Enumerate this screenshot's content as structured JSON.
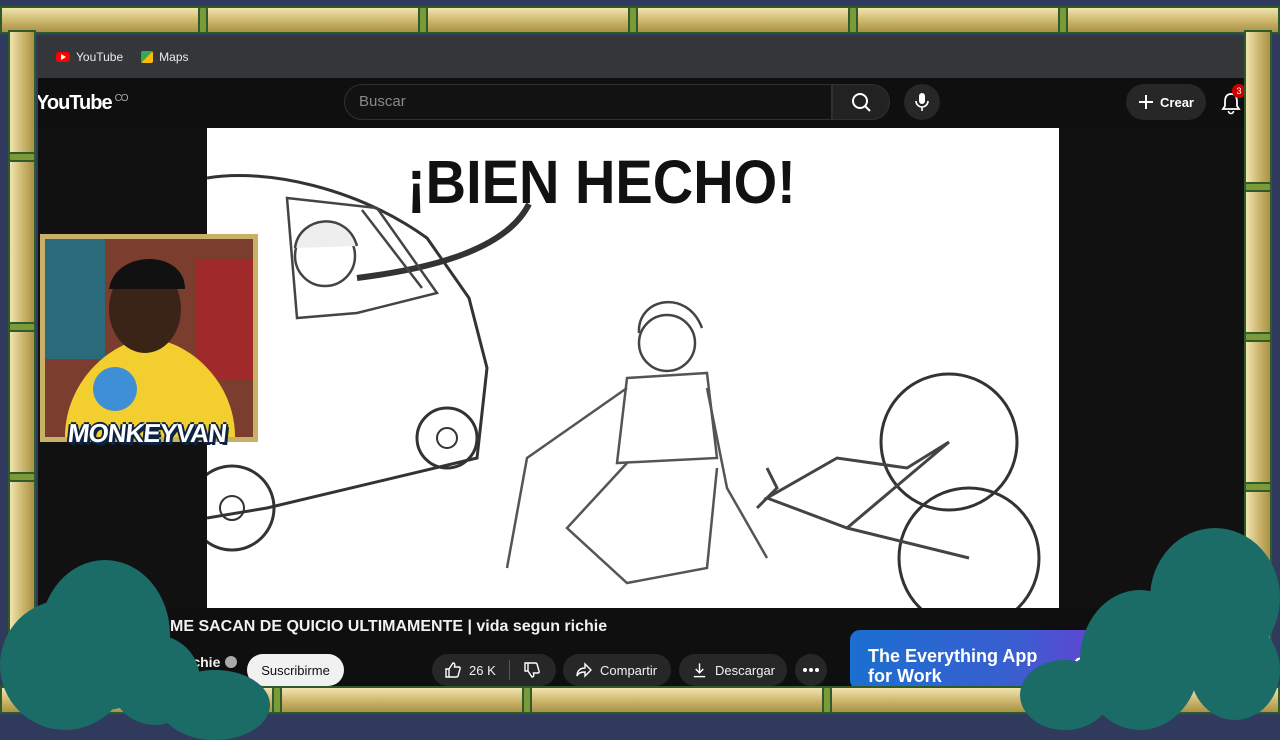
{
  "bookmarks": [
    {
      "label": "YouTube",
      "icon": "youtube-icon"
    },
    {
      "label": "Maps",
      "icon": "maps-icon"
    }
  ],
  "header": {
    "logo_text": "YouTube",
    "logo_country": "CO",
    "search_placeholder": "Buscar",
    "create_label": "Crear",
    "notification_count": "3"
  },
  "video": {
    "speech_bubble": "¡BIEN HECHO!",
    "title": "ME SACAN DE QUICIO ULTIMAMENTE | vida segun richie",
    "channel_name": "richie",
    "subscribe_label": "Suscribirme",
    "like_count": "26 K",
    "share_label": "Compartir",
    "download_label": "Descargar"
  },
  "ad": {
    "headline": "The Everything App for Work",
    "cta": "Get"
  },
  "overlay": {
    "streamer_logo": "MONKEYVAN"
  },
  "colors": {
    "bamboo": "#c8b167",
    "bamboo_knot": "#7d9a3b",
    "bush": "#1b6b67",
    "youtube_red": "#ff0000",
    "background": "#0f0f0f"
  }
}
